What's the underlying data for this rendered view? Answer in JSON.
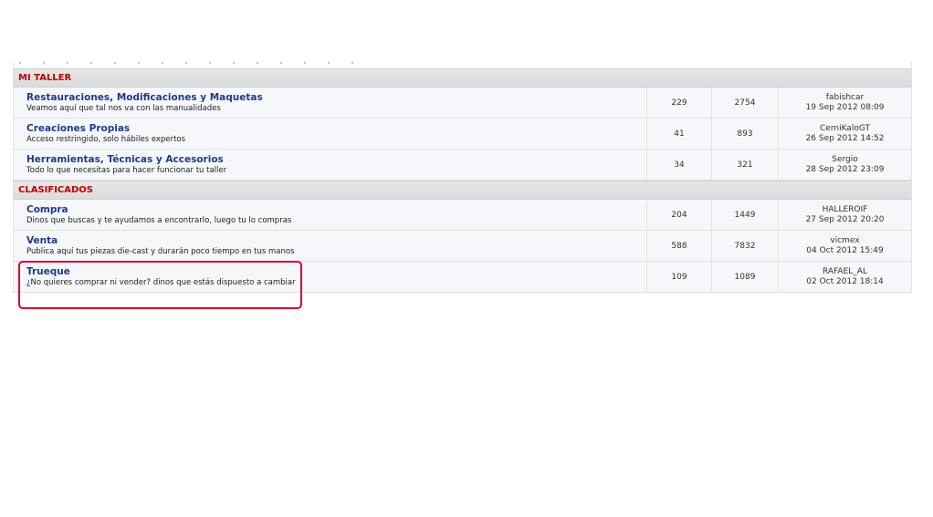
{
  "categories": [
    {
      "name": "MI TALLER",
      "forums": [
        {
          "title": "Restauraciones, Modificaciones y Maquetas",
          "desc": "Veamos aquí que tal nos va con las manualidades",
          "topics": "229",
          "posts": "2754",
          "last_user": "fabishcar",
          "last_date": "19 Sep 2012 08:09"
        },
        {
          "title": "Creaciones Propias",
          "desc": "Acceso restringido, solo hábiles expertos",
          "topics": "41",
          "posts": "893",
          "last_user": "CerniKaloGT",
          "last_date": "26 Sep 2012 14:52"
        },
        {
          "title": "Herramientas, Técnicas y Accesorios",
          "desc": "Todo lo que necesitas para hacer funcionar tu taller",
          "topics": "34",
          "posts": "321",
          "last_user": "Sergio",
          "last_date": "28 Sep 2012 23:09"
        }
      ]
    },
    {
      "name": "CLASIFICADOS",
      "forums": [
        {
          "title": "Compra",
          "desc": "Dinos que buscas y te ayudamos a encontrarlo, luego tu lo compras",
          "topics": "204",
          "posts": "1449",
          "last_user": "HALLEROIF",
          "last_date": "27 Sep 2012 20:20"
        },
        {
          "title": "Venta",
          "desc": "Publica aquí tus piezas die-cast y durarán poco tiempo en tus manos",
          "topics": "588",
          "posts": "7832",
          "last_user": "vicmex",
          "last_date": "04 Oct 2012 15:49"
        },
        {
          "title": "Trueque",
          "desc": "¿No quieres comprar ni vender? dinos que estás dispuesto a cambiar",
          "topics": "109",
          "posts": "1089",
          "last_user": "RAFAEL_AL",
          "last_date": "02 Oct 2012 18:14"
        }
      ]
    }
  ],
  "colors": {
    "category_text": "#c00000",
    "forum_link": "#1f3a8a",
    "highlight": "#d9002b"
  }
}
